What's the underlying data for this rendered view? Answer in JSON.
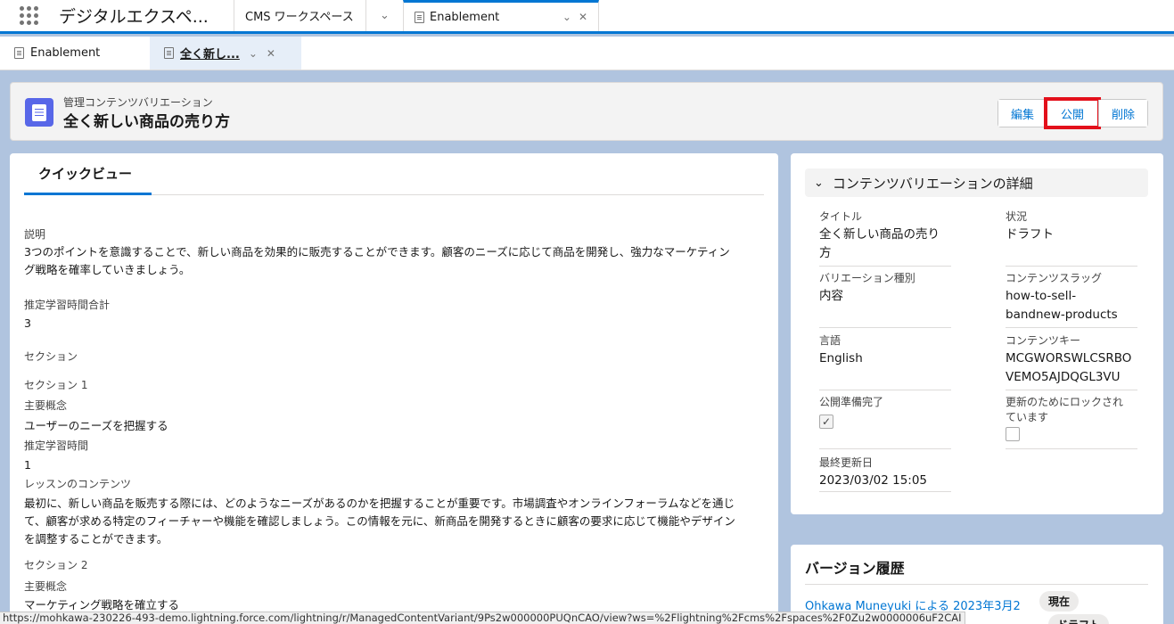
{
  "app": {
    "name": "デジタルエクスペ..."
  },
  "nav_tabs": [
    {
      "label": "CMS ワークスペース"
    },
    {
      "label": "Enablement"
    }
  ],
  "sub_tabs": [
    {
      "label": "Enablement"
    },
    {
      "label": "全く新し..."
    }
  ],
  "header": {
    "type": "管理コンテンツバリエーション",
    "title": "全く新しい商品の売り方",
    "buttons": {
      "edit": "編集",
      "publish": "公開",
      "delete": "削除"
    }
  },
  "quickview": {
    "tab": "クイックビュー",
    "desc_label": "説明",
    "desc_line1": "3つのポイントを意識することで、新しい商品を効果的に販売することができます。顧客のニーズに応じて商品を開発し、強力なマーケティン",
    "desc_line2": "グ戦略を確率していきましょう。",
    "total_label": "推定学習時間合計",
    "total_value": "3",
    "section_label": "セクション",
    "s1": {
      "title": "セクション 1",
      "concept_label": "主要概念",
      "concept_value": "ユーザーのニーズを把握する",
      "time_label": "推定学習時間",
      "time_value": "1",
      "content_label": "レッスンのコンテンツ",
      "content_line1": "最初に、新しい商品を販売する際には、どのようなニーズがあるのかを把握することが重要です。市場調査やオンラインフォーラムなどを通じ",
      "content_line2": "て、顧客が求める特定のフィーチャーや機能を確認しましょう。この情報を元に、新商品を開発するときに顧客の要求に応じて機能やデザイン",
      "content_line3": "を調整することができます。"
    },
    "s2": {
      "title": "セクション 2",
      "concept_label": "主要概念",
      "concept_value": "マーケティング戦略を確立する"
    }
  },
  "detail": {
    "header": "コンテンツバリエーションの詳細",
    "title_label": "タイトル",
    "title_line1": "全く新しい商品の売り",
    "title_line2": "方",
    "status_label": "状況",
    "status_value": "ドラフト",
    "var_label": "バリエーション種別",
    "var_value": "内容",
    "slug_label": "コンテンツスラッグ",
    "slug_line1": "how-to-sell-",
    "slug_line2": "bandnew-products",
    "lang_label": "言語",
    "lang_value": "English",
    "key_label": "コンテンツキー",
    "key_line1": "MCGWORSWLCSRBO",
    "key_line2": "VEMO5AJDQGL3VU",
    "ready_label": "公開準備完了",
    "lock_line1": "更新のためにロックされ",
    "lock_line2": "ています",
    "updated_label": "最終更新日",
    "updated_value": "2023/03/02 15:05"
  },
  "version": {
    "title": "バージョン履歴",
    "link": "Ohkawa Muneyuki による 2023年3月2",
    "badge_current": "現在",
    "badge_draft": "ドラフト"
  },
  "statusbar": {
    "url": "https://mohkawa-230226-493-demo.lightning.force.com/lightning/r/ManagedContentVariant/9Ps2w000000PUQnCAO/view?ws=%2Flightning%2Fcms%2Fspaces%2F0Zu2w0000006uF2CAI"
  },
  "icons": [
    "app-launcher-icon",
    "chevron-down-icon",
    "close-icon",
    "document-icon",
    "checkbox-checked-icon"
  ],
  "colors": {
    "brand": "#0176d3",
    "highlight": "#e3101b",
    "content_icon": "#5867e8"
  }
}
